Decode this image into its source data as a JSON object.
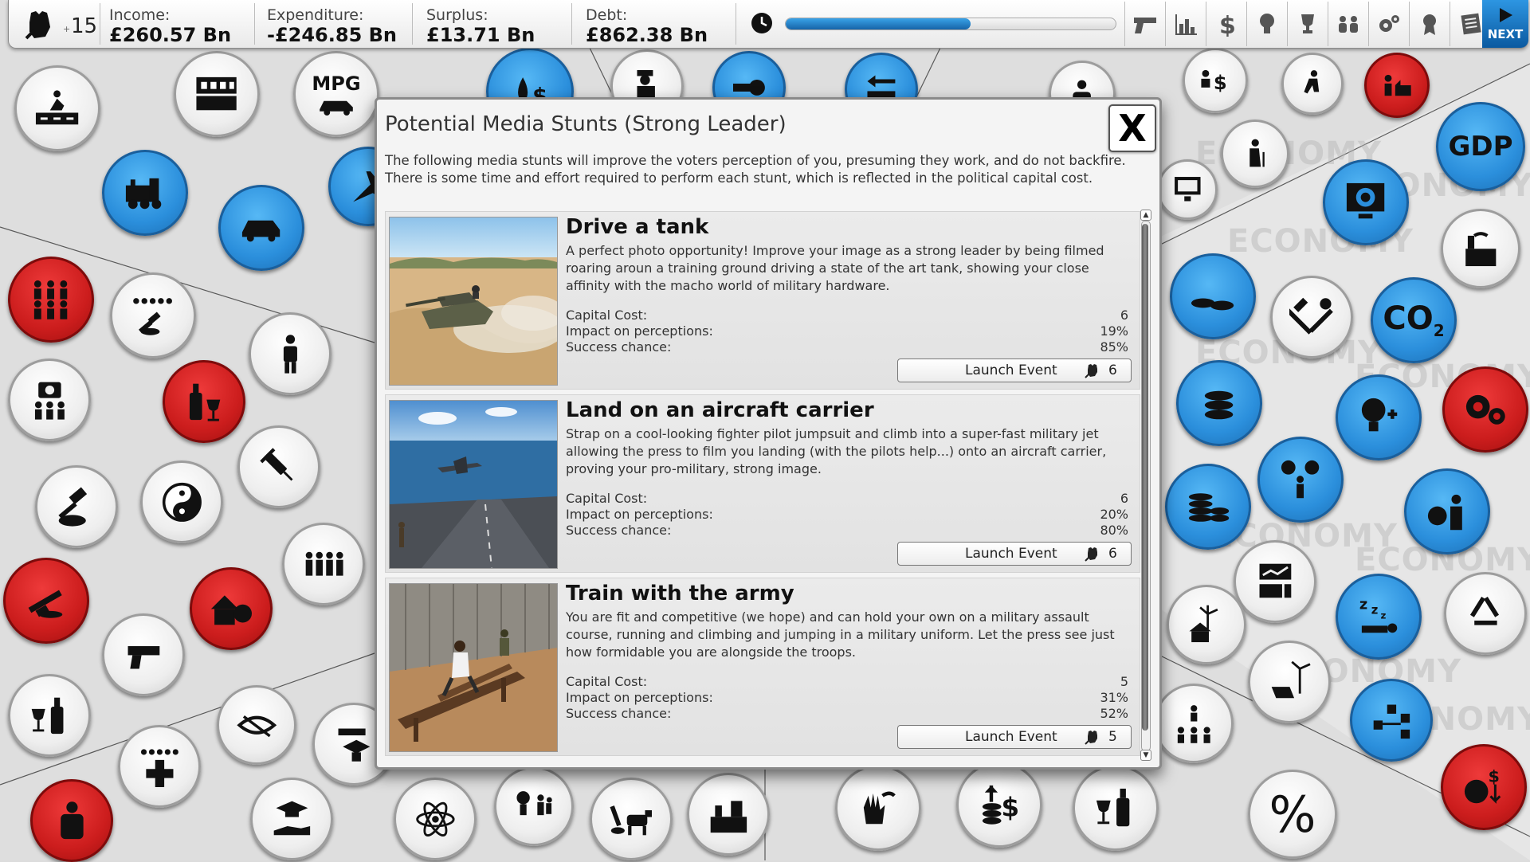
{
  "topbar": {
    "political_capital_prefix": "+",
    "political_capital": "15",
    "stats": [
      {
        "label": "Income:",
        "value": "£260.57 Bn"
      },
      {
        "label": "Expenditure:",
        "value": "-£246.85 Bn"
      },
      {
        "label": "Surplus:",
        "value": "£13.71 Bn"
      },
      {
        "label": "Debt:",
        "value": "£862.38 Bn"
      }
    ],
    "turn_progress": 0.56,
    "tools": [
      "gun-icon",
      "bar-chart-icon",
      "dollar-icon",
      "lightbulb-icon",
      "trophy-icon",
      "people-icon",
      "gears-icon",
      "award-icon",
      "newspaper-icon"
    ],
    "next_label": "NEXT"
  },
  "background": {
    "watermark": "ECONOMY",
    "labels": {
      "mpg": "MPG",
      "gdp": "GDP",
      "co2": "CO",
      "co2_sub": "2",
      "percent": "%"
    }
  },
  "dialog": {
    "title": "Potential Media Stunts (Strong Leader)",
    "close_label": "X",
    "description": "The following media stunts will improve the voters perception of you, presuming they work, and do not backfire. There is some time and effort required to perform each stunt, which is reflected in the political capital cost.",
    "stat_labels": {
      "cost": "Capital Cost:",
      "impact": "Impact on perceptions:",
      "success": "Success chance:"
    },
    "stunts": [
      {
        "title": "Drive a tank",
        "description": "A perfect photo opportunity! Improve your image as a strong leader by being filmed roaring aroun a training ground driving a state of the art tank, showing your close affinity with the macho world of military hardware.",
        "capital_cost": "6",
        "impact": "19%",
        "success": "85%",
        "button_label": "Launch Event",
        "button_cost": "6",
        "image": "tank-photo"
      },
      {
        "title": "Land on an aircraft carrier",
        "description": "Strap on a cool-looking fighter pilot jumpsuit and climb into a super-fast military jet allowing the press to film you landing (with the pilots help...) onto an aircraft carrier, proving your pro-military, strong image.",
        "capital_cost": "6",
        "impact": "20%",
        "success": "80%",
        "button_label": "Launch Event",
        "button_cost": "6",
        "image": "carrier-photo"
      },
      {
        "title": "Train with the army",
        "description": "You are fit and competitive (we hope) and can hold your own on a military assault course, running and climbing and jumping in a military uniform. Let the press see just how formidable you are alongside the troops.",
        "capital_cost": "5",
        "impact": "31%",
        "success": "52%",
        "button_label": "Launch Event",
        "button_cost": "5",
        "image": "assault-course-photo"
      }
    ]
  }
}
